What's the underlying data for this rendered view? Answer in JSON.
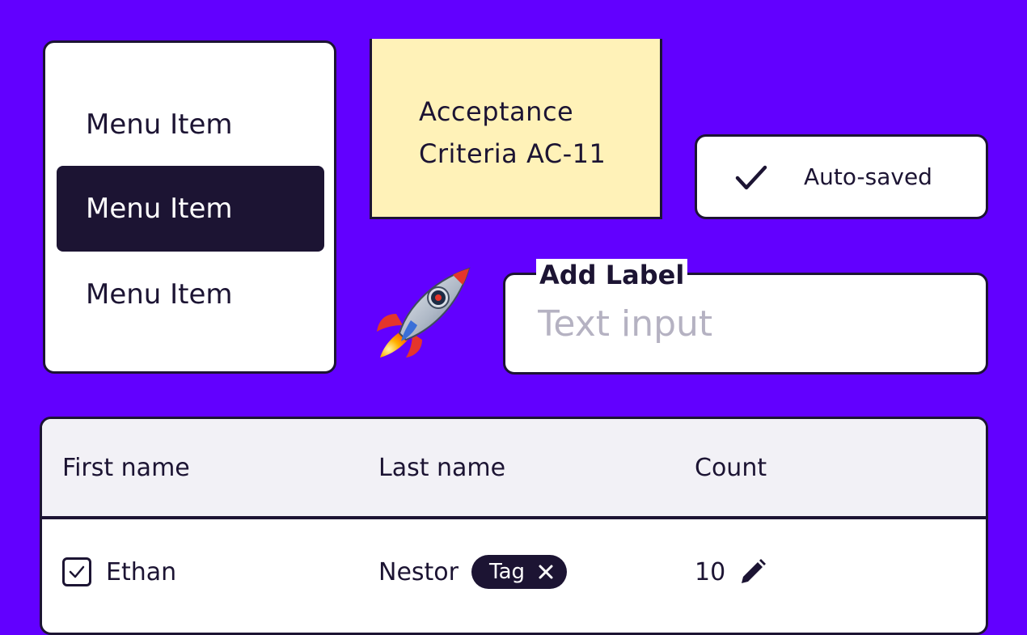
{
  "menu": {
    "items": [
      {
        "label": "Menu Item",
        "selected": false
      },
      {
        "label": "Menu Item",
        "selected": true
      },
      {
        "label": "Menu Item",
        "selected": false
      }
    ]
  },
  "sticky_note": {
    "lines": [
      "Acceptance",
      "Criteria AC-11"
    ]
  },
  "autosave": {
    "icon": "checkmark-icon",
    "label": "Auto-saved"
  },
  "decoration": {
    "icon": "rocket-icon"
  },
  "text_input": {
    "label": "Add Label",
    "placeholder": "Text input",
    "value": ""
  },
  "table": {
    "columns": [
      "First name",
      "Last name",
      "Count"
    ],
    "rows": [
      {
        "checked": true,
        "first_name": "Ethan",
        "last_name": "Nestor",
        "tag": "Tag",
        "count": "10"
      }
    ]
  },
  "colors": {
    "background": "#6200ff",
    "ink": "#1c1433",
    "sticky": "#fff2b8",
    "header_bg": "#f2f1f6",
    "placeholder": "#b5b2c2"
  }
}
